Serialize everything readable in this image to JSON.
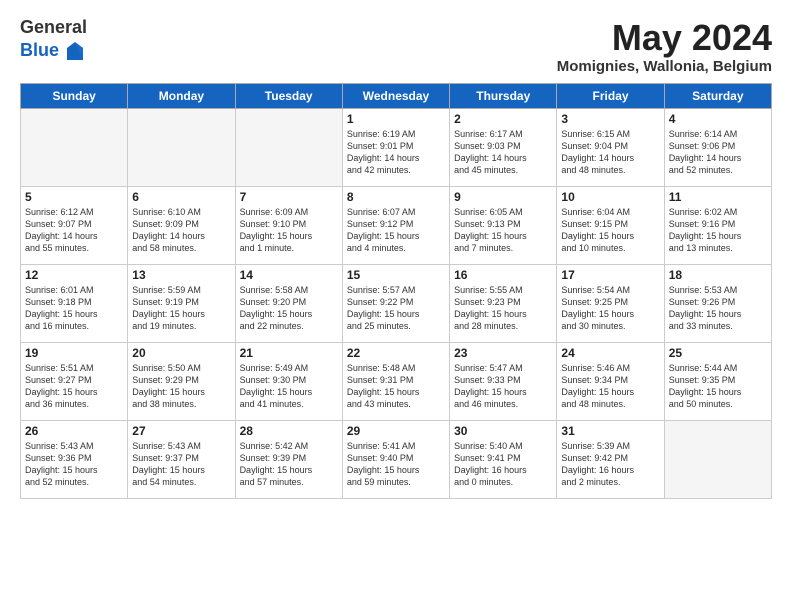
{
  "header": {
    "logo_general": "General",
    "logo_blue": "Blue",
    "title": "May 2024",
    "location": "Momignies, Wallonia, Belgium"
  },
  "days_of_week": [
    "Sunday",
    "Monday",
    "Tuesday",
    "Wednesday",
    "Thursday",
    "Friday",
    "Saturday"
  ],
  "weeks": [
    [
      {
        "day": "",
        "info": ""
      },
      {
        "day": "",
        "info": ""
      },
      {
        "day": "",
        "info": ""
      },
      {
        "day": "1",
        "info": "Sunrise: 6:19 AM\nSunset: 9:01 PM\nDaylight: 14 hours\nand 42 minutes."
      },
      {
        "day": "2",
        "info": "Sunrise: 6:17 AM\nSunset: 9:03 PM\nDaylight: 14 hours\nand 45 minutes."
      },
      {
        "day": "3",
        "info": "Sunrise: 6:15 AM\nSunset: 9:04 PM\nDaylight: 14 hours\nand 48 minutes."
      },
      {
        "day": "4",
        "info": "Sunrise: 6:14 AM\nSunset: 9:06 PM\nDaylight: 14 hours\nand 52 minutes."
      }
    ],
    [
      {
        "day": "5",
        "info": "Sunrise: 6:12 AM\nSunset: 9:07 PM\nDaylight: 14 hours\nand 55 minutes."
      },
      {
        "day": "6",
        "info": "Sunrise: 6:10 AM\nSunset: 9:09 PM\nDaylight: 14 hours\nand 58 minutes."
      },
      {
        "day": "7",
        "info": "Sunrise: 6:09 AM\nSunset: 9:10 PM\nDaylight: 15 hours\nand 1 minute."
      },
      {
        "day": "8",
        "info": "Sunrise: 6:07 AM\nSunset: 9:12 PM\nDaylight: 15 hours\nand 4 minutes."
      },
      {
        "day": "9",
        "info": "Sunrise: 6:05 AM\nSunset: 9:13 PM\nDaylight: 15 hours\nand 7 minutes."
      },
      {
        "day": "10",
        "info": "Sunrise: 6:04 AM\nSunset: 9:15 PM\nDaylight: 15 hours\nand 10 minutes."
      },
      {
        "day": "11",
        "info": "Sunrise: 6:02 AM\nSunset: 9:16 PM\nDaylight: 15 hours\nand 13 minutes."
      }
    ],
    [
      {
        "day": "12",
        "info": "Sunrise: 6:01 AM\nSunset: 9:18 PM\nDaylight: 15 hours\nand 16 minutes."
      },
      {
        "day": "13",
        "info": "Sunrise: 5:59 AM\nSunset: 9:19 PM\nDaylight: 15 hours\nand 19 minutes."
      },
      {
        "day": "14",
        "info": "Sunrise: 5:58 AM\nSunset: 9:20 PM\nDaylight: 15 hours\nand 22 minutes."
      },
      {
        "day": "15",
        "info": "Sunrise: 5:57 AM\nSunset: 9:22 PM\nDaylight: 15 hours\nand 25 minutes."
      },
      {
        "day": "16",
        "info": "Sunrise: 5:55 AM\nSunset: 9:23 PM\nDaylight: 15 hours\nand 28 minutes."
      },
      {
        "day": "17",
        "info": "Sunrise: 5:54 AM\nSunset: 9:25 PM\nDaylight: 15 hours\nand 30 minutes."
      },
      {
        "day": "18",
        "info": "Sunrise: 5:53 AM\nSunset: 9:26 PM\nDaylight: 15 hours\nand 33 minutes."
      }
    ],
    [
      {
        "day": "19",
        "info": "Sunrise: 5:51 AM\nSunset: 9:27 PM\nDaylight: 15 hours\nand 36 minutes."
      },
      {
        "day": "20",
        "info": "Sunrise: 5:50 AM\nSunset: 9:29 PM\nDaylight: 15 hours\nand 38 minutes."
      },
      {
        "day": "21",
        "info": "Sunrise: 5:49 AM\nSunset: 9:30 PM\nDaylight: 15 hours\nand 41 minutes."
      },
      {
        "day": "22",
        "info": "Sunrise: 5:48 AM\nSunset: 9:31 PM\nDaylight: 15 hours\nand 43 minutes."
      },
      {
        "day": "23",
        "info": "Sunrise: 5:47 AM\nSunset: 9:33 PM\nDaylight: 15 hours\nand 46 minutes."
      },
      {
        "day": "24",
        "info": "Sunrise: 5:46 AM\nSunset: 9:34 PM\nDaylight: 15 hours\nand 48 minutes."
      },
      {
        "day": "25",
        "info": "Sunrise: 5:44 AM\nSunset: 9:35 PM\nDaylight: 15 hours\nand 50 minutes."
      }
    ],
    [
      {
        "day": "26",
        "info": "Sunrise: 5:43 AM\nSunset: 9:36 PM\nDaylight: 15 hours\nand 52 minutes."
      },
      {
        "day": "27",
        "info": "Sunrise: 5:43 AM\nSunset: 9:37 PM\nDaylight: 15 hours\nand 54 minutes."
      },
      {
        "day": "28",
        "info": "Sunrise: 5:42 AM\nSunset: 9:39 PM\nDaylight: 15 hours\nand 57 minutes."
      },
      {
        "day": "29",
        "info": "Sunrise: 5:41 AM\nSunset: 9:40 PM\nDaylight: 15 hours\nand 59 minutes."
      },
      {
        "day": "30",
        "info": "Sunrise: 5:40 AM\nSunset: 9:41 PM\nDaylight: 16 hours\nand 0 minutes."
      },
      {
        "day": "31",
        "info": "Sunrise: 5:39 AM\nSunset: 9:42 PM\nDaylight: 16 hours\nand 2 minutes."
      },
      {
        "day": "",
        "info": ""
      }
    ]
  ]
}
